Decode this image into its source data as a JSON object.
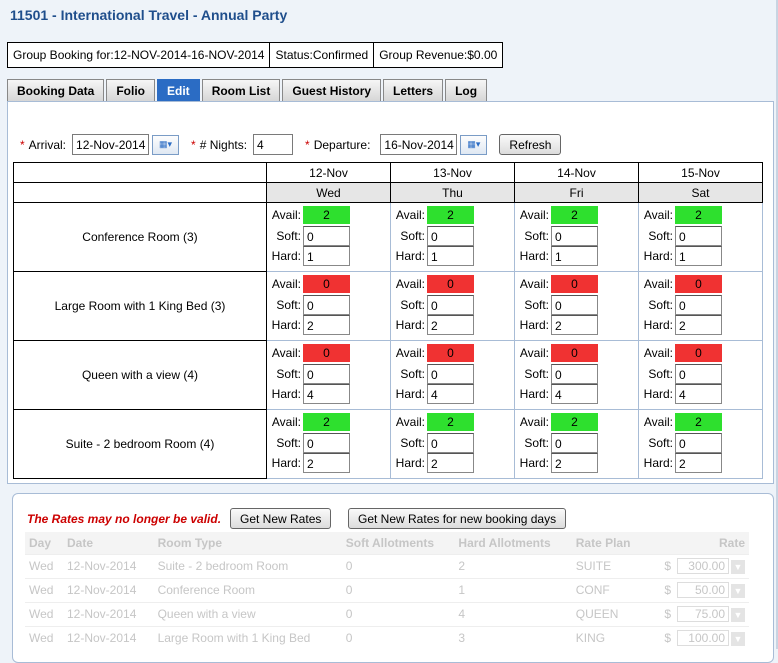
{
  "title": "11501 - International Travel - Annual Party",
  "summary": {
    "group": "Group Booking for:12-NOV-2014-16-NOV-2014",
    "status": "Status:Confirmed",
    "revenue": "Group Revenue:$0.00"
  },
  "tabs": [
    "Booking Data",
    "Folio",
    "Edit",
    "Room List",
    "Guest History",
    "Letters",
    "Log"
  ],
  "active_tab": "Edit",
  "form": {
    "arrival_label": "Arrival:",
    "arrival_value": "12-Nov-2014",
    "nights_label": "# Nights:",
    "nights_value": "4",
    "departure_label": "Departure:",
    "departure_value": "16-Nov-2014",
    "refresh_label": "Refresh",
    "required_mark": "*"
  },
  "grid": {
    "dates": [
      "12-Nov",
      "13-Nov",
      "14-Nov",
      "15-Nov"
    ],
    "days": [
      "Wed",
      "Thu",
      "Fri",
      "Sat"
    ],
    "labels": {
      "avail": "Avail:",
      "soft": "Soft:",
      "hard": "Hard:"
    },
    "rooms": [
      {
        "name": "Conference Room (3)",
        "status_color": "#2ee02e",
        "cells": [
          {
            "avail": "2",
            "soft": "0",
            "hard": "1"
          },
          {
            "avail": "2",
            "soft": "0",
            "hard": "1"
          },
          {
            "avail": "2",
            "soft": "0",
            "hard": "1"
          },
          {
            "avail": "2",
            "soft": "0",
            "hard": "1"
          }
        ]
      },
      {
        "name": "Large Room with 1 King Bed (3)",
        "status_color": "#f03232",
        "cells": [
          {
            "avail": "0",
            "soft": "0",
            "hard": "2"
          },
          {
            "avail": "0",
            "soft": "0",
            "hard": "2"
          },
          {
            "avail": "0",
            "soft": "0",
            "hard": "2"
          },
          {
            "avail": "0",
            "soft": "0",
            "hard": "2"
          }
        ]
      },
      {
        "name": "Queen with a view (4)",
        "status_color": "#f03232",
        "cells": [
          {
            "avail": "0",
            "soft": "0",
            "hard": "4"
          },
          {
            "avail": "0",
            "soft": "0",
            "hard": "4"
          },
          {
            "avail": "0",
            "soft": "0",
            "hard": "4"
          },
          {
            "avail": "0",
            "soft": "0",
            "hard": "4"
          }
        ]
      },
      {
        "name": "Suite - 2 bedroom Room (4)",
        "status_color": "#2ee02e",
        "cells": [
          {
            "avail": "2",
            "soft": "0",
            "hard": "2"
          },
          {
            "avail": "2",
            "soft": "0",
            "hard": "2"
          },
          {
            "avail": "2",
            "soft": "0",
            "hard": "2"
          },
          {
            "avail": "2",
            "soft": "0",
            "hard": "2"
          }
        ]
      }
    ]
  },
  "rates": {
    "warning": "The Rates may no longer be valid.",
    "get_new_rates": "Get New Rates",
    "get_new_rates_days": "Get New Rates for new booking days",
    "columns": [
      "Day",
      "Date",
      "Room Type",
      "Soft Allotments",
      "Hard Allotments",
      "Rate Plan",
      "Rate"
    ],
    "currency": "$",
    "rows": [
      {
        "day": "Wed",
        "date": "12-Nov-2014",
        "room": "Suite - 2 bedroom Room",
        "soft": "0",
        "hard": "2",
        "plan": "SUITE",
        "rate": "300.00"
      },
      {
        "day": "Wed",
        "date": "12-Nov-2014",
        "room": "Conference Room",
        "soft": "0",
        "hard": "1",
        "plan": "CONF",
        "rate": "50.00"
      },
      {
        "day": "Wed",
        "date": "12-Nov-2014",
        "room": "Queen with a view",
        "soft": "0",
        "hard": "4",
        "plan": "QUEEN",
        "rate": "75.00"
      },
      {
        "day": "Wed",
        "date": "12-Nov-2014",
        "room": "Large Room with 1 King Bed",
        "soft": "0",
        "hard": "3",
        "plan": "KING",
        "rate": "100.00"
      }
    ]
  }
}
